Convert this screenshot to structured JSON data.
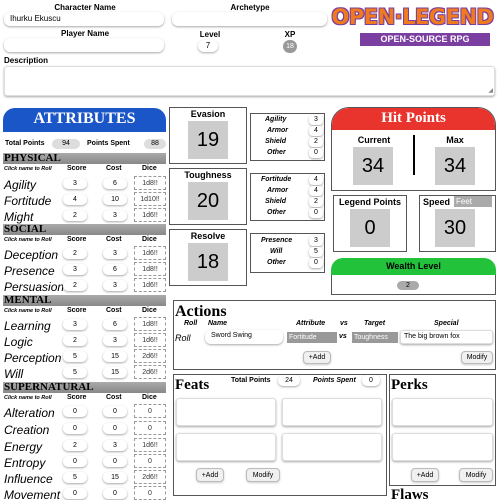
{
  "header": {
    "character_name_label": "Character Name",
    "character_name_value": "Ihurku Ekuscu",
    "archetype_label": "Archetype",
    "archetype_value": "",
    "player_name_label": "Player Name",
    "player_name_value": "",
    "level_label": "Level",
    "level_value": "7",
    "xp_label": "XP",
    "xp_value": "18",
    "description_label": "Description",
    "logo_main": "OPEN·LEGEND",
    "logo_sub": "OPEN-SOURCE RPG"
  },
  "attributes": {
    "title": "ATTRIBUTES",
    "total_points_label": "Total Points",
    "total_points_value": "94",
    "points_spent_label": "Points Spent",
    "points_spent_value": "88",
    "click_hint": "Click name to Roll",
    "col_score": "Score",
    "col_cost": "Cost",
    "col_dice": "Dice",
    "sections": [
      {
        "name": "PHYSICAL",
        "rows": [
          {
            "name": "Agility",
            "score": "3",
            "cost": "6",
            "dice": "1d8!!"
          },
          {
            "name": "Fortitude",
            "score": "4",
            "cost": "10",
            "dice": "1d10!!"
          },
          {
            "name": "Might",
            "score": "2",
            "cost": "3",
            "dice": "1d6!!"
          }
        ]
      },
      {
        "name": "SOCIAL",
        "rows": [
          {
            "name": "Deception",
            "score": "2",
            "cost": "3",
            "dice": "1d6!!"
          },
          {
            "name": "Presence",
            "score": "3",
            "cost": "6",
            "dice": "1d8!!"
          },
          {
            "name": "Persuasion",
            "score": "2",
            "cost": "3",
            "dice": "1d6!!"
          }
        ]
      },
      {
        "name": "MENTAL",
        "rows": [
          {
            "name": "Learning",
            "score": "3",
            "cost": "6",
            "dice": "1d8!!"
          },
          {
            "name": "Logic",
            "score": "2",
            "cost": "3",
            "dice": "1d6!!"
          },
          {
            "name": "Perception",
            "score": "5",
            "cost": "15",
            "dice": "2d6!!"
          },
          {
            "name": "Will",
            "score": "5",
            "cost": "15",
            "dice": "2d6!!"
          }
        ]
      },
      {
        "name": "SUPERNATURAL",
        "rows": [
          {
            "name": "Alteration",
            "score": "0",
            "cost": "0",
            "dice": "0"
          },
          {
            "name": "Creation",
            "score": "0",
            "cost": "0",
            "dice": "0"
          },
          {
            "name": "Energy",
            "score": "2",
            "cost": "3",
            "dice": "1d6!!"
          },
          {
            "name": "Entropy",
            "score": "0",
            "cost": "0",
            "dice": "0"
          },
          {
            "name": "Influence",
            "score": "5",
            "cost": "15",
            "dice": "2d6!!"
          },
          {
            "name": "Movement",
            "score": "0",
            "cost": "0",
            "dice": "0"
          }
        ]
      }
    ]
  },
  "defenses": {
    "evasion": {
      "label": "Evasion",
      "value": "19",
      "rows": [
        {
          "label": "Agility",
          "value": "3"
        },
        {
          "label": "Armor",
          "value": "4"
        },
        {
          "label": "Shield",
          "value": "2"
        },
        {
          "label": "Other",
          "value": "0"
        }
      ]
    },
    "toughness": {
      "label": "Toughness",
      "value": "20",
      "rows": [
        {
          "label": "Fortitude",
          "value": "4"
        },
        {
          "label": "Armor",
          "value": "4"
        },
        {
          "label": "Shield",
          "value": "2"
        },
        {
          "label": "Other",
          "value": "0"
        }
      ]
    },
    "resolve": {
      "label": "Resolve",
      "value": "18",
      "rows": [
        {
          "label": "Presence",
          "value": "3"
        },
        {
          "label": "Will",
          "value": "5"
        },
        {
          "label": "Other",
          "value": "0"
        }
      ]
    }
  },
  "hit_points": {
    "title": "Hit Points",
    "current_label": "Current",
    "current_value": "34",
    "max_label": "Max",
    "max_value": "34"
  },
  "legend_points": {
    "label": "Legend Points",
    "value": "0"
  },
  "speed": {
    "label": "Speed",
    "unit": "Feet",
    "value": "30"
  },
  "wealth": {
    "label": "Wealth Level",
    "value": "2"
  },
  "actions": {
    "title": "Actions",
    "col_roll": "Roll",
    "col_name": "Name",
    "col_attribute": "Attribute",
    "col_vs1": "vs",
    "col_target": "Target",
    "col_special": "Special",
    "row": {
      "roll": "Roll",
      "name": "Sword Swing",
      "attribute": "Fortitude",
      "vs": "vs",
      "target": "Toughness",
      "special": "The big brown fox"
    },
    "add_label": "+Add",
    "modify_label": "Modify"
  },
  "feats": {
    "title": "Feats",
    "total_points_label": "Total Points",
    "total_points_value": "24",
    "points_spent_label": "Points Spent",
    "points_spent_value": "0",
    "add_label": "+Add",
    "modify_label": "Modify"
  },
  "perks": {
    "title": "Perks",
    "add_label": "+Add",
    "modify_label": "Modify"
  },
  "flaws": {
    "title": "Flaws"
  },
  "colors": {
    "attr_blue": "#1a56c8",
    "hp_red": "#e8342c",
    "wealth_green": "#22c33a",
    "logo_orange": "#f07a1e",
    "logo_purple": "#7a3fa0"
  }
}
